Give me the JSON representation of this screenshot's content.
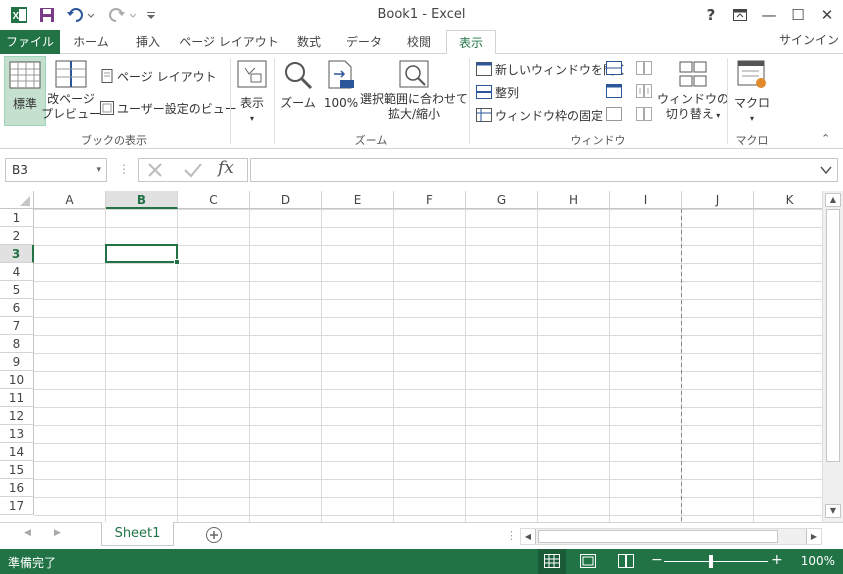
{
  "title_bar": {
    "title": "Book1 - Excel",
    "help": "?",
    "minimize": "—",
    "maximize": "☐",
    "close": "✕"
  },
  "tabs": [
    {
      "label": "ファイル"
    },
    {
      "label": "ホーム"
    },
    {
      "label": "挿入"
    },
    {
      "label": "ページ レイアウト"
    },
    {
      "label": "数式"
    },
    {
      "label": "データ"
    },
    {
      "label": "校閲"
    },
    {
      "label": "表示"
    }
  ],
  "signin": "サインイン",
  "ribbon": {
    "normal": "標準",
    "page_break": [
      "改ページ",
      "プレビュー"
    ],
    "page_layout": "ページ レイアウト",
    "custom_views": "ユーザー設定のビュー",
    "book_views_label": "ブックの表示",
    "show": "表示",
    "zoom": "ズーム",
    "zoom_100": "100%",
    "zoom_selection": [
      "選択範囲に合わせて",
      "拡大/縮小"
    ],
    "zoom_label": "ズーム",
    "new_window": "新しいウィンドウを開く",
    "arrange": "整列",
    "freeze": "ウィンドウ枠の固定",
    "switch_windows": [
      "ウィンドウの",
      "切り替え"
    ],
    "window_label": "ウィンドウ",
    "macros": "マクロ",
    "macros_label": "マクロ"
  },
  "formula_bar": {
    "name_box": "B3",
    "fx": "fx",
    "value": ""
  },
  "columns": [
    "A",
    "B",
    "C",
    "D",
    "E",
    "F",
    "G",
    "H",
    "I",
    "J",
    "K"
  ],
  "rows": [
    "1",
    "2",
    "3",
    "4",
    "5",
    "6",
    "7",
    "8",
    "9",
    "10",
    "11",
    "12",
    "13",
    "14",
    "15",
    "16",
    "17"
  ],
  "selected_cell": {
    "column": "B",
    "row": "3"
  },
  "sheet_tab": "Sheet1",
  "status": {
    "ready": "準備完了",
    "zoom": "100%"
  },
  "colors": {
    "accent": "#217346",
    "selection_header": "#e1e1e1"
  }
}
